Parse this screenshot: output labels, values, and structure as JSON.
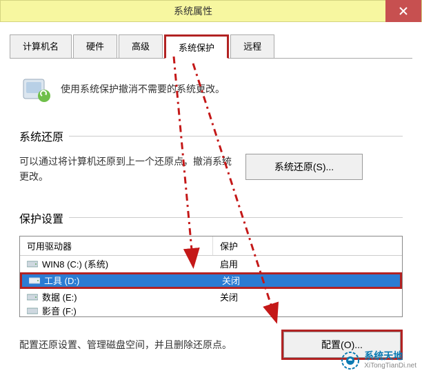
{
  "titlebar": {
    "title": "系统属性"
  },
  "tabs": {
    "t0": "计算机名",
    "t1": "硬件",
    "t2": "高级",
    "t3": "系统保护",
    "t4": "远程"
  },
  "intro": "使用系统保护撤消不需要的系统更改。",
  "restore": {
    "group_label": "系统还原",
    "desc": "可以通过将计算机还原到上一个还原点，撤消系统更改。",
    "button": "系统还原(S)..."
  },
  "protection": {
    "group_label": "保护设置",
    "header_drive": "可用驱动器",
    "header_protect": "保护",
    "rows": [
      {
        "name": "WIN8 (C:) (系统)",
        "status": "启用"
      },
      {
        "name": "工具 (D:)",
        "status": "关闭"
      },
      {
        "name": "数据 (E:)",
        "status": "关闭"
      },
      {
        "name": "影音 (F:)",
        "status": ""
      }
    ],
    "config_desc": "配置还原设置、管理磁盘空间，并且删除还原点。",
    "config_button": "配置(O)..."
  },
  "watermark": {
    "zh": "系统天地",
    "en": "XiTongTianDi.net"
  }
}
